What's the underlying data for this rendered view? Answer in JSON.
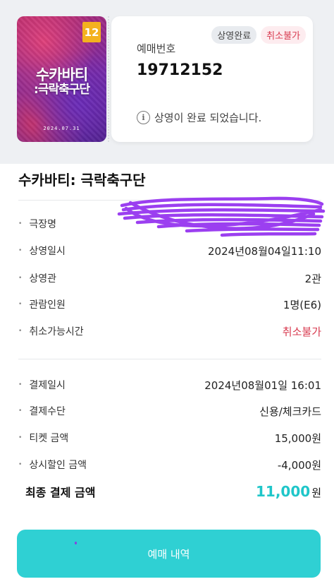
{
  "ticket": {
    "age_rating": "12",
    "poster_title_line1": "수카바티",
    "poster_title_line2": ":극락축구단",
    "poster_date": "2024.07.31",
    "status_badge": "상영완료",
    "cancel_badge": "취소불가",
    "reservation_label": "예매번호",
    "reservation_number": "19712152",
    "notice": "상영이 완료 되었습니다."
  },
  "movie_title": "수카바티: 극락축구단",
  "details": [
    {
      "label": "극장명",
      "value": ""
    },
    {
      "label": "상영일시",
      "value": "2024년08월04일11:10"
    },
    {
      "label": "상영관",
      "value": "2관"
    },
    {
      "label": "관람인원",
      "value": "1명(E6)"
    },
    {
      "label": "취소가능시간",
      "value": "취소불가"
    }
  ],
  "payment": [
    {
      "label": "결제일시",
      "value": "2024년08월01일 16:01"
    },
    {
      "label": "결제수단",
      "value": "신용/체크카드"
    },
    {
      "label": "티켓 금액",
      "value": "15,000원"
    },
    {
      "label": "상시할인 금액",
      "value": "-4,000원"
    }
  ],
  "final": {
    "label": "최종 결제 금액",
    "amount": "11,000",
    "unit": "원"
  },
  "cta_label": "예매 내역",
  "colors": {
    "accent": "#2fd0d3",
    "accent_text": "#1fc6c9",
    "danger": "#d83b50",
    "redaction": "#9b3ff0"
  }
}
